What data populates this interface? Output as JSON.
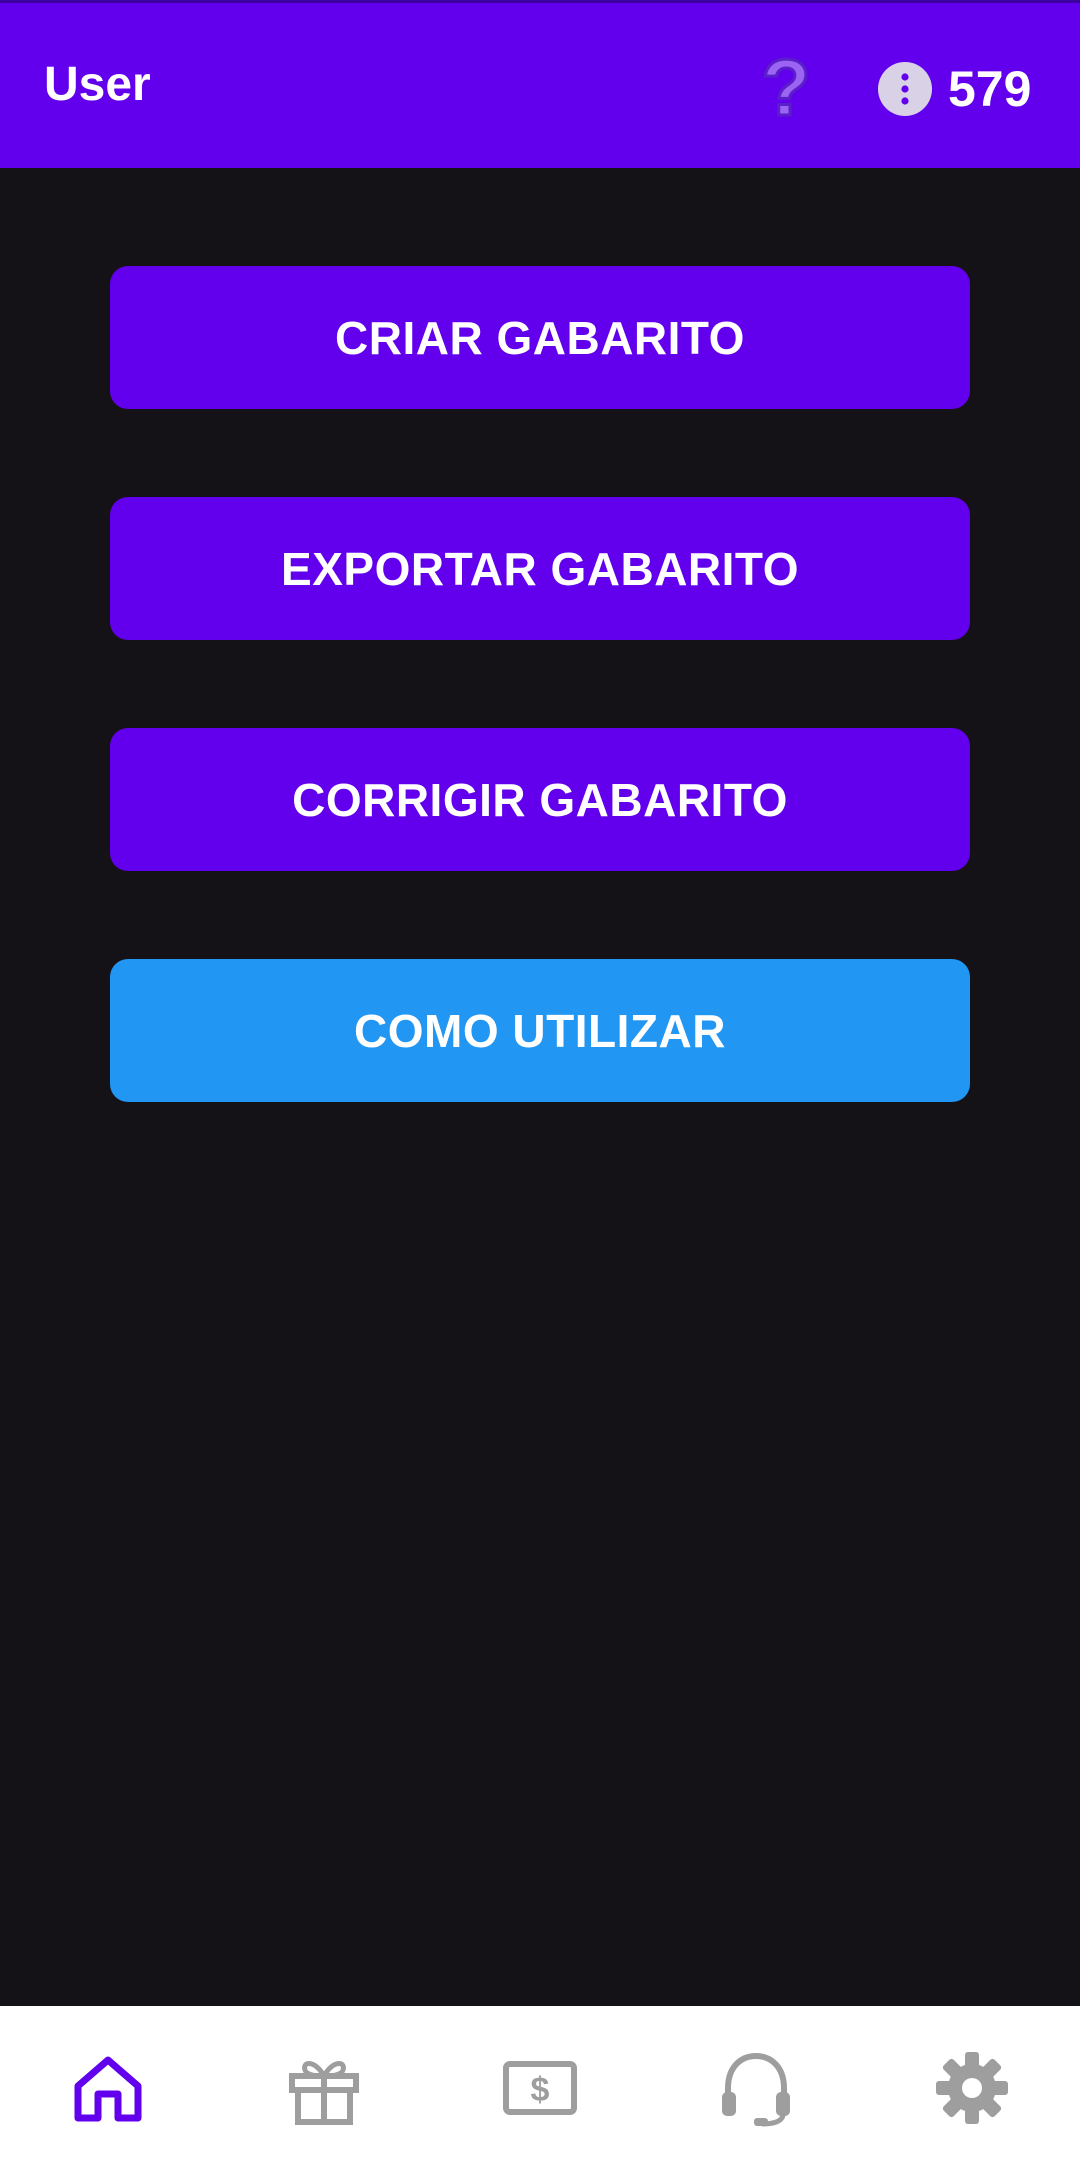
{
  "header": {
    "title": "User",
    "help_icon": "question-mark-icon",
    "coin_icon": "coin-icon",
    "coin_count": "579"
  },
  "menu": {
    "buttons": [
      {
        "label": "CRIAR GABARITO",
        "color": "#6200EE"
      },
      {
        "label": "EXPORTAR GABARITO",
        "color": "#6200EE"
      },
      {
        "label": "CORRIGIR GABARITO",
        "color": "#6200EE"
      },
      {
        "label": "COMO UTILIZAR",
        "color": "#2196F3"
      }
    ]
  },
  "bottom_nav": {
    "items": [
      {
        "icon": "home-icon",
        "active": true
      },
      {
        "icon": "gift-icon",
        "active": false
      },
      {
        "icon": "dollar-bill-icon",
        "active": false
      },
      {
        "icon": "headset-support-icon",
        "active": false
      },
      {
        "icon": "gear-icon",
        "active": false
      }
    ],
    "active_color": "#6200EE",
    "inactive_color": "#9E9E9E"
  },
  "colors": {
    "primary": "#6200EE",
    "info": "#2196F3",
    "background": "#141217"
  }
}
